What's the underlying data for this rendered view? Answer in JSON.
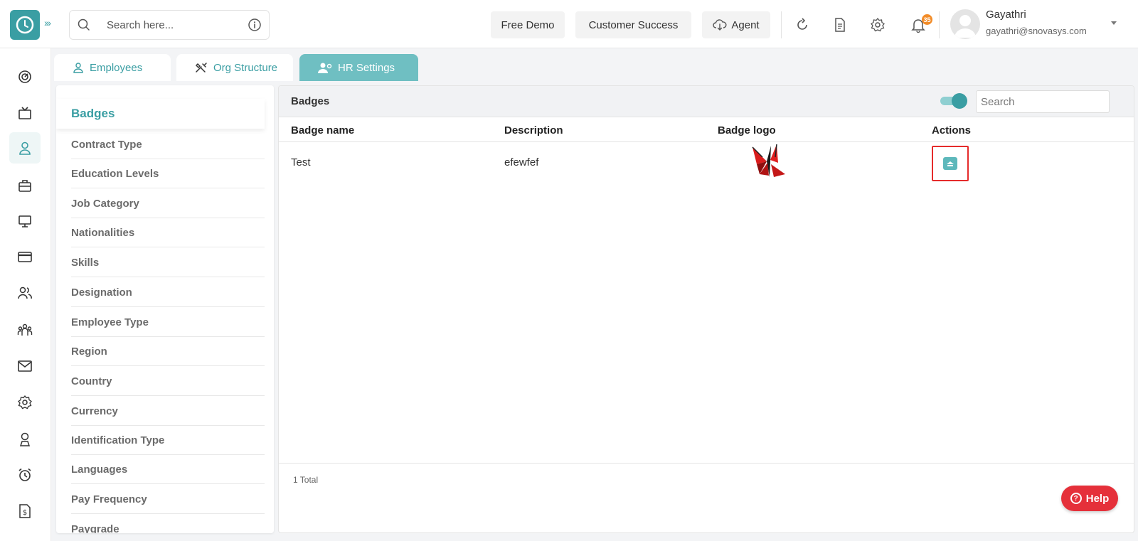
{
  "header": {
    "search_placeholder": "Search here...",
    "buttons": {
      "free_demo": "Free Demo",
      "customer_success": "Customer Success",
      "agent": "Agent"
    },
    "notification_count": "35",
    "user": {
      "name": "Gayathri",
      "email": "gayathri@snovasys.com"
    }
  },
  "sidebar": {
    "icons": [
      "dashboard-icon",
      "tv-icon",
      "user-icon",
      "briefcase-icon",
      "monitor-icon",
      "card-icon",
      "users-icon",
      "team-icon",
      "mail-icon",
      "settings-icon",
      "award-icon",
      "alarm-icon",
      "invoice-icon"
    ],
    "active_index": 2
  },
  "tabs": [
    {
      "label": "Employees",
      "icon": "user-icon",
      "active": false
    },
    {
      "label": "Org Structure",
      "icon": "tools-icon",
      "active": false
    },
    {
      "label": "HR Settings",
      "icon": "user-settings-icon",
      "active": true
    }
  ],
  "settings_menu": {
    "active": "Badges",
    "items": [
      "Contract Type",
      "Education Levels",
      "Job Category",
      "Nationalities",
      "Skills",
      "Designation",
      "Employee Type",
      "Region",
      "Country",
      "Currency",
      "Identification Type",
      "Languages",
      "Pay Frequency",
      "Paygrade"
    ]
  },
  "panel": {
    "title": "Badges",
    "search_placeholder": "Search",
    "columns": [
      "Badge name",
      "Description",
      "Badge logo",
      "Actions"
    ],
    "rows": [
      {
        "badge_name": "Test",
        "description": "efewfef"
      }
    ],
    "total": "1 Total"
  },
  "help": {
    "label": "Help"
  },
  "colors": {
    "accent": "#3a9ea3",
    "tab_active": "#6fbfc2",
    "help": "#e5303a",
    "highlight": "#e52b2b"
  }
}
